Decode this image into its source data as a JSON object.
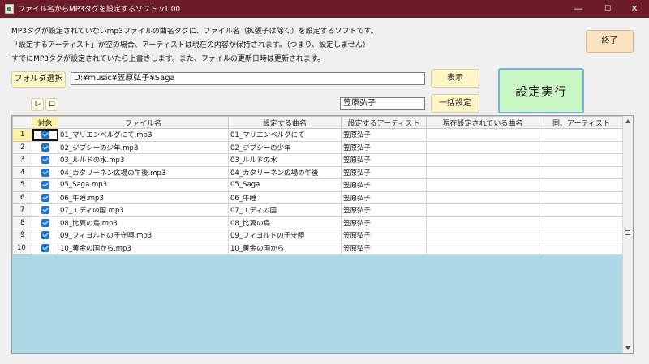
{
  "window": {
    "title": "ファイル名からMP3タグを設定するソフト v1.00",
    "min_glyph": "—",
    "max_glyph": "☐",
    "close_glyph": "✕"
  },
  "description": [
    "MP3タグが設定されていないmp3ファイルの曲名タグに、ファイル名（拡張子は除く）を設定するソフトです。",
    "「設定するアーティスト」が空の場合、アーティストは現在の内容が保持されます。（つまり、設定しません）",
    "すでにMP3タグが設定されていたら上書きします。また、ファイルの更新日時は更新されます。"
  ],
  "buttons": {
    "exit": "終了",
    "folder_select": "フォルダ選択",
    "show": "表示",
    "bulk_set": "一括設定",
    "run": "設定実行",
    "check_all": "レ",
    "uncheck_all": "ロ"
  },
  "inputs": {
    "folder_path": "D:¥music¥笠原弘子¥Saga",
    "artist": "笠原弘子"
  },
  "grid": {
    "columns": [
      "対象",
      "ファイル名",
      "設定する曲名",
      "設定するアーティスト",
      "現在設定されている曲名",
      "同、アーティスト"
    ],
    "rows": [
      {
        "no": "1",
        "checked": true,
        "file": "01_マリエンベルグにて.mp3",
        "title": "01_マリエンベルグにて",
        "artist": "笠原弘子",
        "cur_title": "",
        "cur_artist": ""
      },
      {
        "no": "2",
        "checked": true,
        "file": "02_ジプシーの少年.mp3",
        "title": "02_ジプシーの少年",
        "artist": "笠原弘子",
        "cur_title": "",
        "cur_artist": ""
      },
      {
        "no": "3",
        "checked": true,
        "file": "03_ルルドの水.mp3",
        "title": "03_ルルドの水",
        "artist": "笠原弘子",
        "cur_title": "",
        "cur_artist": ""
      },
      {
        "no": "4",
        "checked": true,
        "file": "04_カタリーネン広場の午後.mp3",
        "title": "04_カタリーネン広場の午後",
        "artist": "笠原弘子",
        "cur_title": "",
        "cur_artist": ""
      },
      {
        "no": "5",
        "checked": true,
        "file": "05_Saga.mp3",
        "title": "05_Saga",
        "artist": "笠原弘子",
        "cur_title": "",
        "cur_artist": ""
      },
      {
        "no": "6",
        "checked": true,
        "file": "06_午睡.mp3",
        "title": "06_午睡",
        "artist": "笠原弘子",
        "cur_title": "",
        "cur_artist": ""
      },
      {
        "no": "7",
        "checked": true,
        "file": "07_エディの国.mp3",
        "title": "07_エディの国",
        "artist": "笠原弘子",
        "cur_title": "",
        "cur_artist": ""
      },
      {
        "no": "8",
        "checked": true,
        "file": "08_比翼の鳥.mp3",
        "title": "08_比翼の鳥",
        "artist": "笠原弘子",
        "cur_title": "",
        "cur_artist": ""
      },
      {
        "no": "9",
        "checked": true,
        "file": "09_フィヨルドの子守唄.mp3",
        "title": "09_フィヨルドの子守唄",
        "artist": "笠原弘子",
        "cur_title": "",
        "cur_artist": ""
      },
      {
        "no": "10",
        "checked": true,
        "file": "10_黄金の国から.mp3",
        "title": "10_黄金の国から",
        "artist": "笠原弘子",
        "cur_title": "",
        "cur_artist": ""
      }
    ]
  },
  "colors": {
    "titlebar": "#6b1d2a",
    "button_face": "#fff5c6",
    "exit_button": "#fbe3c2",
    "run_button": "#c9f7c3",
    "grid_background": "#add8e6",
    "checkbox": "#1a73d9",
    "selected_header": "#fff1a8"
  },
  "icons": [
    "app-icon",
    "minimize-icon",
    "maximize-icon",
    "close-icon",
    "checkbox-checked-icon",
    "scroll-up-icon",
    "scroll-down-icon"
  ]
}
